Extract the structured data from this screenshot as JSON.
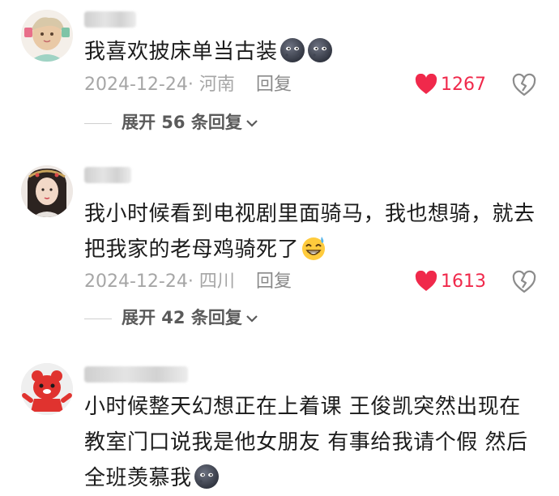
{
  "comments": [
    {
      "text": "我喜欢披床单当古装",
      "date_location": "2024-12-24· 河南",
      "reply_label": "回复",
      "likes": "1267",
      "expand_label": "展开 56 条回复"
    },
    {
      "text": "我小时候看到电视剧里面骑马，我也想骑，就去把我家的老母鸡骑死了",
      "date_location": "2024-12-24· 四川",
      "reply_label": "回复",
      "likes": "1613",
      "expand_label": "展开 42 条回复"
    },
    {
      "text": "小时候整天幻想正在上着课 王俊凯突然出现在教室门口说我是他女朋友 有事给我请个假 然后全班羡慕我"
    }
  ],
  "colors": {
    "like_red": "#f0294b",
    "meta_gray": "#a6a6a6"
  },
  "icons": {
    "like": "heart-icon",
    "dislike": "broken-heart-icon",
    "expand": "chevron-down-icon"
  }
}
